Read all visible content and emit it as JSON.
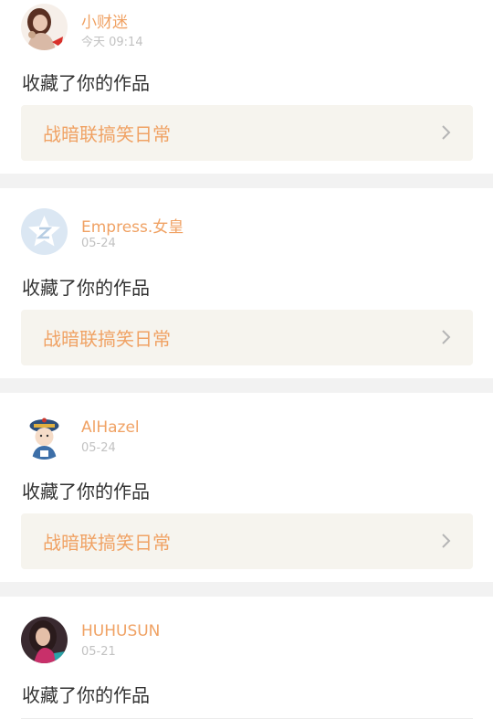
{
  "notifications": [
    {
      "username": "小财迷",
      "timestamp": "今天 09:14",
      "action": "收藏了你的作品",
      "work_title": "战暗联搞笑日常",
      "avatar_icon": "girl-portrait-avatar-icon",
      "chevron_icon": "chevron-right-icon"
    },
    {
      "username": "Empress.女皇",
      "timestamp": "05-24",
      "action": "收藏了你的作品",
      "work_title": "战暗联搞笑日常",
      "avatar_icon": "default-z-star-avatar-icon",
      "chevron_icon": "chevron-right-icon"
    },
    {
      "username": "AlHazel",
      "timestamp": "05-24",
      "action": "收藏了你的作品",
      "work_title": "战暗联搞笑日常",
      "avatar_icon": "cartoon-qing-official-avatar-icon",
      "chevron_icon": "chevron-right-icon"
    },
    {
      "username": "HUHUSUN",
      "timestamp": "05-21",
      "action": "收藏了你的作品",
      "avatar_icon": "woman-photo-avatar-icon"
    }
  ],
  "colors": {
    "accent": "#f0a264",
    "timestamp": "#c2c2c2",
    "text": "#333333",
    "card_bg": "#ffffff",
    "page_bg": "#f2f2f2",
    "link_bg": "#f6f4ee"
  }
}
